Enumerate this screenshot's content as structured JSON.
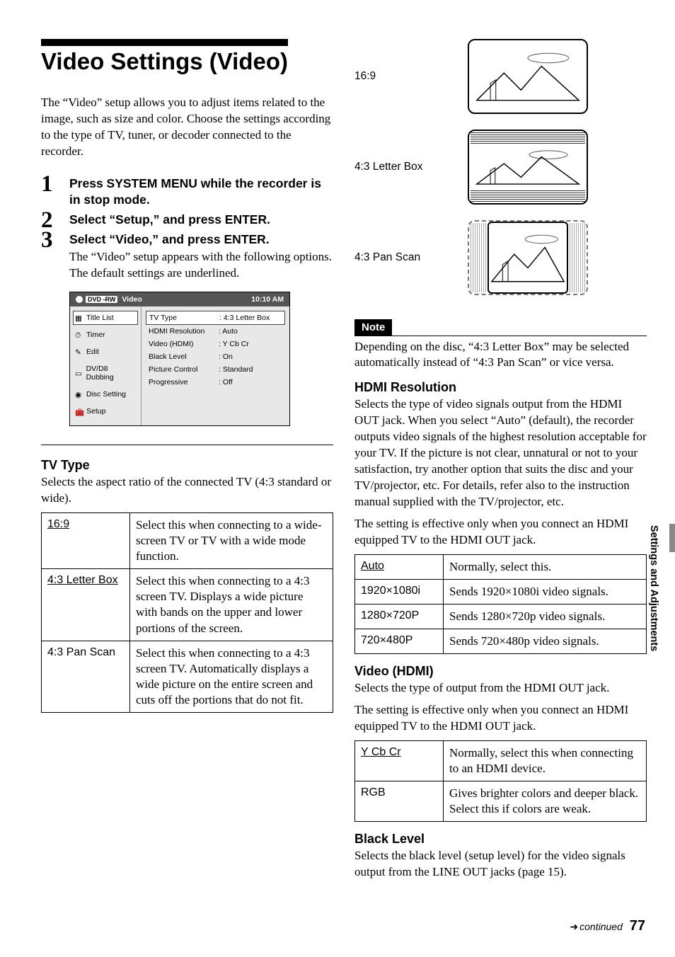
{
  "title": "Video Settings (Video)",
  "intro": "The “Video” setup allows you to adjust items related to the image, such as size and color. Choose the settings according to the type of TV, tuner, or decoder connected to the recorder.",
  "steps": [
    {
      "head": "Press SYSTEM MENU while the recorder is in stop mode.",
      "body": ""
    },
    {
      "head": "Select “Setup,” and press ENTER.",
      "body": ""
    },
    {
      "head": "Select “Video,” and press ENTER.",
      "body": "The “Video” setup appears with the following options. The default settings are underlined."
    }
  ],
  "osd": {
    "dvd_tag": "DVD -RW",
    "header_label": "Video",
    "time": "10:10 AM",
    "sidebar": [
      "Title List",
      "Timer",
      "Edit",
      "DV/D8 Dubbing",
      "Disc Setting",
      "Setup"
    ],
    "rows": [
      {
        "k": "TV Type",
        "v": "4:3 Letter Box",
        "selected": true
      },
      {
        "k": "HDMI Resolution",
        "v": "Auto"
      },
      {
        "k": "Video (HDMI)",
        "v": "Y Cb Cr"
      },
      {
        "k": "Black Level",
        "v": "On"
      },
      {
        "k": "Picture Control",
        "v": "Standard"
      },
      {
        "k": "Progressive",
        "v": "Off"
      }
    ]
  },
  "tv_type": {
    "heading": "TV Type",
    "desc": "Selects the aspect ratio of the connected TV (4:3 standard or wide).",
    "options": [
      {
        "key": "16:9",
        "underline": true,
        "desc": "Select this when connecting to a wide-screen TV or TV with a wide mode function."
      },
      {
        "key": "4:3 Letter Box",
        "underline": true,
        "desc": "Select this when connecting to a 4:3 screen TV. Displays a wide picture with bands on the upper and lower portions of the screen."
      },
      {
        "key": "4:3 Pan Scan",
        "underline": false,
        "desc": "Select this when connecting to a 4:3 screen TV. Automatically displays a wide picture on the entire screen and cuts off the portions that do not fit."
      }
    ]
  },
  "aspects": {
    "a": "16:9",
    "b": "4:3 Letter Box",
    "c": "4:3 Pan Scan"
  },
  "note": {
    "label": "Note",
    "text": "Depending on the disc, “4:3 Letter Box” may be selected automatically instead of “4:3 Pan Scan” or vice versa."
  },
  "hdmi_res": {
    "heading": "HDMI Resolution",
    "desc": "Selects the type of video signals output from the HDMI OUT jack. When you select “Auto” (default), the recorder outputs video signals of the highest resolution acceptable for your TV. If the picture is not clear, unnatural or not to your satisfaction, try another option that suits the disc and your TV/projector, etc. For details, refer also to the instruction manual supplied with the TV/projector, etc.",
    "desc2": "The setting is effective only when you connect an HDMI equipped TV to the HDMI OUT jack.",
    "options": [
      {
        "key": "Auto",
        "underline": true,
        "desc": "Normally, select this."
      },
      {
        "key": "1920×1080i",
        "desc": "Sends 1920×1080i video signals."
      },
      {
        "key": "1280×720P",
        "desc": "Sends 1280×720p video signals."
      },
      {
        "key": "720×480P",
        "desc": "Sends 720×480p video signals."
      }
    ]
  },
  "video_hdmi": {
    "heading": "Video (HDMI)",
    "desc": "Selects the type of output from the HDMI OUT jack.",
    "desc2": "The setting is effective only when you connect an HDMI equipped TV to the HDMI OUT jack.",
    "options": [
      {
        "key": "Y Cb Cr",
        "underline": true,
        "desc": "Normally, select this when connecting to an HDMI device."
      },
      {
        "key": "RGB",
        "desc": "Gives brighter colors and deeper black. Select this if colors are weak."
      }
    ]
  },
  "black_level": {
    "heading": "Black Level",
    "desc": "Selects the black level (setup level) for the video signals output from the LINE OUT jacks (page 15)."
  },
  "side_tab": "Settings and Adjustments",
  "footer": {
    "continued": "continued",
    "page": "77"
  }
}
